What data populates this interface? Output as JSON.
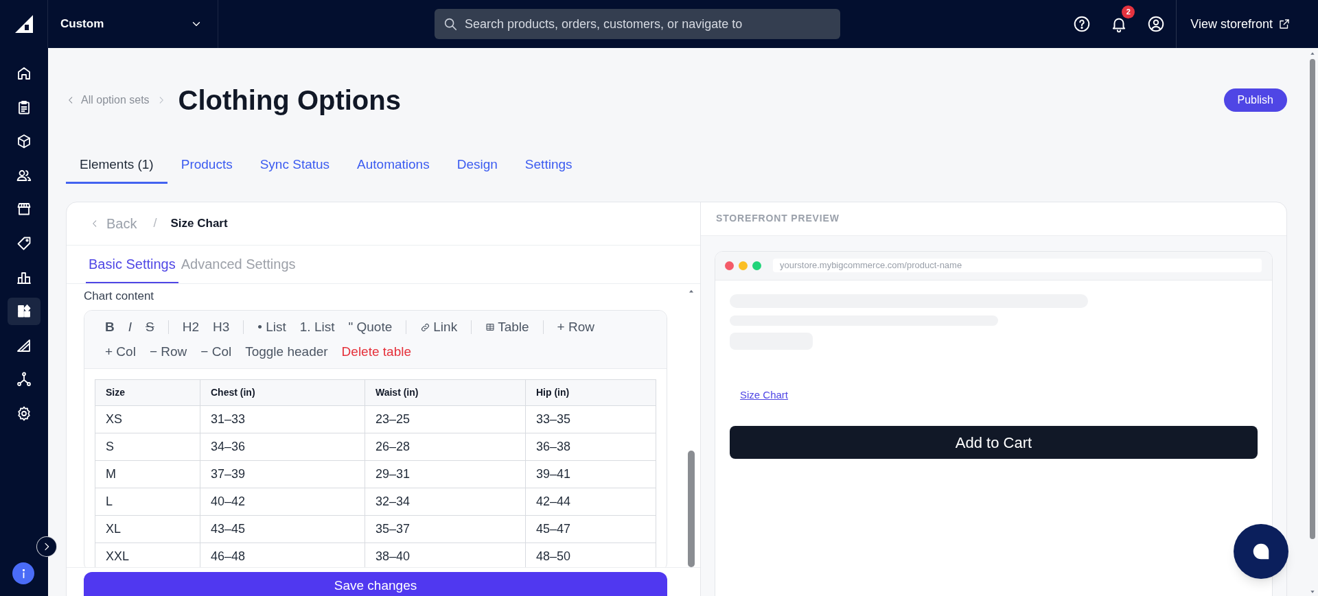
{
  "top_bar": {
    "store_selector": "Custom",
    "search": {
      "placeholder": "Search products, orders, customers, or navigate to"
    },
    "notification_count": "2",
    "storefront_link": "View storefront"
  },
  "sidebar": {
    "items": [
      {
        "selected": false
      },
      {
        "selected": false
      },
      {
        "selected": false
      },
      {
        "selected": false
      },
      {
        "selected": false
      },
      {
        "selected": false
      },
      {
        "selected": false
      },
      {
        "selected": true
      },
      {
        "selected": false
      },
      {
        "selected": false
      },
      {
        "selected": false
      }
    ]
  },
  "breadcrumb": "All option sets",
  "title": "Clothing Options",
  "publish_button": "Publish",
  "tabs": [
    {
      "label": "Elements (1)",
      "selected": true
    },
    {
      "label": "Products",
      "selected": false
    },
    {
      "label": "Sync Status",
      "selected": false
    },
    {
      "label": "Automations",
      "selected": false
    },
    {
      "label": "Design",
      "selected": false
    },
    {
      "label": "Settings",
      "selected": false
    }
  ],
  "editor": {
    "back": "Back",
    "separator": "/",
    "title": "Size Chart",
    "tabs": [
      {
        "label": "Basic Settings",
        "selected": true
      },
      {
        "label": "Advanced Settings",
        "selected": false
      }
    ],
    "field_label": "Chart content",
    "toolbar_rows": [
      [
        [
          {
            "label": "B",
            "kind": "bold"
          },
          {
            "label": "I",
            "kind": "italic"
          },
          {
            "label": "S",
            "kind": "strike"
          }
        ],
        [
          {
            "label": "H2",
            "kind": "plain"
          },
          {
            "label": "H3",
            "kind": "plain"
          }
        ],
        [
          {
            "label": "• List",
            "kind": "plain"
          },
          {
            "label": "1. List",
            "kind": "plain"
          },
          {
            "label": "\" Quote",
            "kind": "plain"
          }
        ],
        [
          {
            "label": "Link",
            "kind": "link"
          }
        ],
        [
          {
            "label": "Table",
            "kind": "table"
          }
        ],
        [
          {
            "label": "+ Row",
            "kind": "plain"
          }
        ]
      ],
      [
        [
          {
            "label": "+ Col",
            "kind": "plain"
          },
          {
            "label": "− Row",
            "kind": "plain"
          },
          {
            "label": "− Col",
            "kind": "plain"
          },
          {
            "label": "Toggle header",
            "kind": "plain"
          },
          {
            "label": "Delete table",
            "kind": "danger"
          }
        ]
      ]
    ],
    "table": {
      "columns": [
        "Size",
        "Chest (in)",
        "Waist (in)",
        "Hip (in)"
      ],
      "rows": [
        [
          "XS",
          "31–33",
          "23–25",
          "33–35"
        ],
        [
          "S",
          "34–36",
          "26–28",
          "36–38"
        ],
        [
          "M",
          "37–39",
          "29–31",
          "39–41"
        ],
        [
          "L",
          "40–42",
          "32–34",
          "42–44"
        ],
        [
          "XL",
          "43–45",
          "35–37",
          "45–47"
        ],
        [
          "XXL",
          "46–48",
          "38–40",
          "48–50"
        ]
      ]
    },
    "save_button": "Save changes"
  },
  "preview": {
    "title": "STOREFRONT PREVIEW",
    "url": "yourstore.mybigcommerce.com/product-name",
    "link": "Size Chart",
    "button": "Add to Cart"
  }
}
